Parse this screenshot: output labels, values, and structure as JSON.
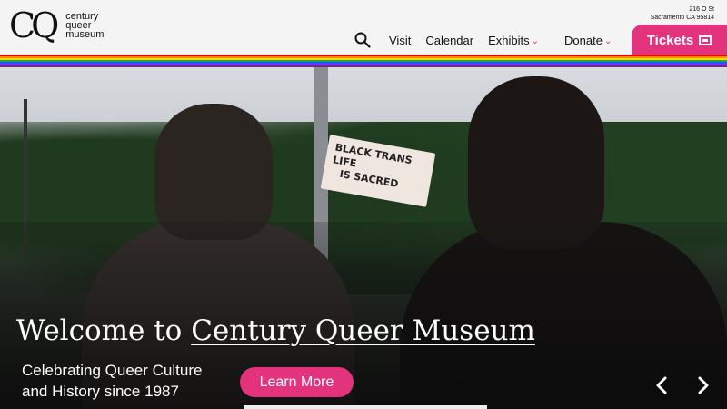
{
  "header": {
    "logo": {
      "mark": "CQ",
      "line1": "century",
      "line2": "queer",
      "line3": "museum"
    },
    "address": {
      "line1": "216 O St",
      "line2": "Sacramento CA 95814"
    },
    "nav": {
      "search_icon": "search-icon",
      "items": [
        {
          "label": "Visit",
          "has_dropdown": false
        },
        {
          "label": "Calendar",
          "has_dropdown": false
        },
        {
          "label": "Exhibits",
          "has_dropdown": true
        },
        {
          "label": "Donate",
          "has_dropdown": true
        }
      ]
    },
    "tickets": {
      "label": "Tickets",
      "icon": "ticket-icon"
    }
  },
  "colors": {
    "accent": "#e2337c",
    "header_bg": "#f4f4f4",
    "rainbow": [
      "#e40303",
      "#ff8c00",
      "#ffd800",
      "#19a84a",
      "#2458ff",
      "#8c2cff",
      "#732982"
    ]
  },
  "hero": {
    "sign": {
      "line1": "BLACK TRANS LIFE",
      "line2": "IS SACRED"
    },
    "title_prefix": "Welcome to",
    "title_link": "Century Queer Museum",
    "subtitle": {
      "line1": "Celebrating Queer Culture",
      "line2": "and History since 1987"
    },
    "cta_label": "Learn More",
    "prev_icon": "chevron-left-icon",
    "next_icon": "chevron-right-icon"
  }
}
